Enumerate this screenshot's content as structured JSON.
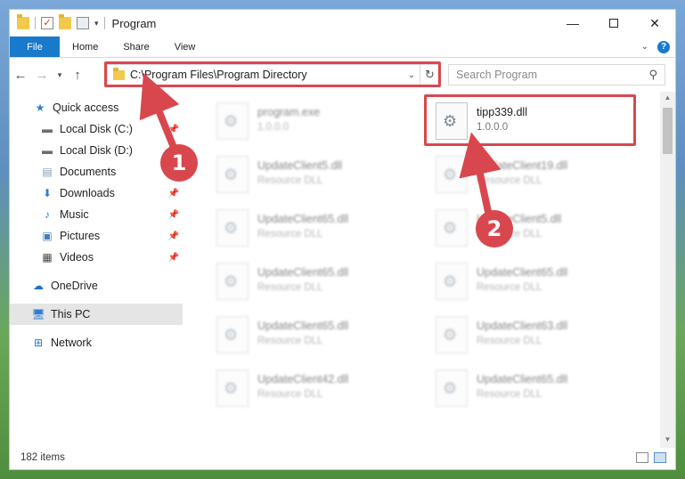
{
  "window": {
    "title": "Program"
  },
  "ribbon": {
    "tabs": [
      "File",
      "Home",
      "Share",
      "View"
    ],
    "help_label": "?"
  },
  "address": {
    "path": "C:\\Program Files\\Program Directory"
  },
  "search": {
    "placeholder": "Search Program"
  },
  "sidebar": {
    "items": [
      {
        "label": "Quick access",
        "icon": "star-icon",
        "pinned": false
      },
      {
        "label": "Local Disk (C:)",
        "icon": "drive-icon",
        "pinned": true
      },
      {
        "label": "Local Disk (D:)",
        "icon": "drive-icon",
        "pinned": false
      },
      {
        "label": "Documents",
        "icon": "documents-icon",
        "pinned": true
      },
      {
        "label": "Downloads",
        "icon": "download-icon",
        "pinned": true
      },
      {
        "label": "Music",
        "icon": "music-icon",
        "pinned": true
      },
      {
        "label": "Pictures",
        "icon": "pictures-icon",
        "pinned": true
      },
      {
        "label": "Videos",
        "icon": "videos-icon",
        "pinned": true
      },
      {
        "label": "OneDrive",
        "icon": "cloud-icon",
        "pinned": false
      },
      {
        "label": "This PC",
        "icon": "computer-icon",
        "pinned": false,
        "selected": true
      },
      {
        "label": "Network",
        "icon": "network-icon",
        "pinned": false
      }
    ]
  },
  "files": [
    {
      "name": "program.exe",
      "sub": "1.0.0.0",
      "blurred": true
    },
    {
      "name": "tipp339.dll",
      "sub": "1.0.0.0",
      "blurred": false,
      "highlighted": true
    },
    {
      "name": "UpdateClient5.dll",
      "sub": "Resource DLL",
      "blurred": true
    },
    {
      "name": "UpdateClient19.dll",
      "sub": "Resource DLL",
      "blurred": true
    },
    {
      "name": "UpdateClient65.dll",
      "sub": "Resource DLL",
      "blurred": true
    },
    {
      "name": "UpdateClient5.dll",
      "sub": "Resource DLL",
      "blurred": true
    },
    {
      "name": "UpdateClient65.dll",
      "sub": "Resource DLL",
      "blurred": true
    },
    {
      "name": "UpdateClient65.dll",
      "sub": "Resource DLL",
      "blurred": true
    },
    {
      "name": "UpdateClient65.dll",
      "sub": "Resource DLL",
      "blurred": true
    },
    {
      "name": "UpdateClient63.dll",
      "sub": "Resource DLL",
      "blurred": true
    },
    {
      "name": "UpdateClient42.dll",
      "sub": "Resource DLL",
      "blurred": true
    },
    {
      "name": "UpdateClient65.dll",
      "sub": "Resource DLL",
      "blurred": true
    }
  ],
  "status": {
    "item_count": "182 items"
  },
  "annotations": {
    "badge_1": "1",
    "badge_2": "2",
    "color": "#d9474e"
  }
}
